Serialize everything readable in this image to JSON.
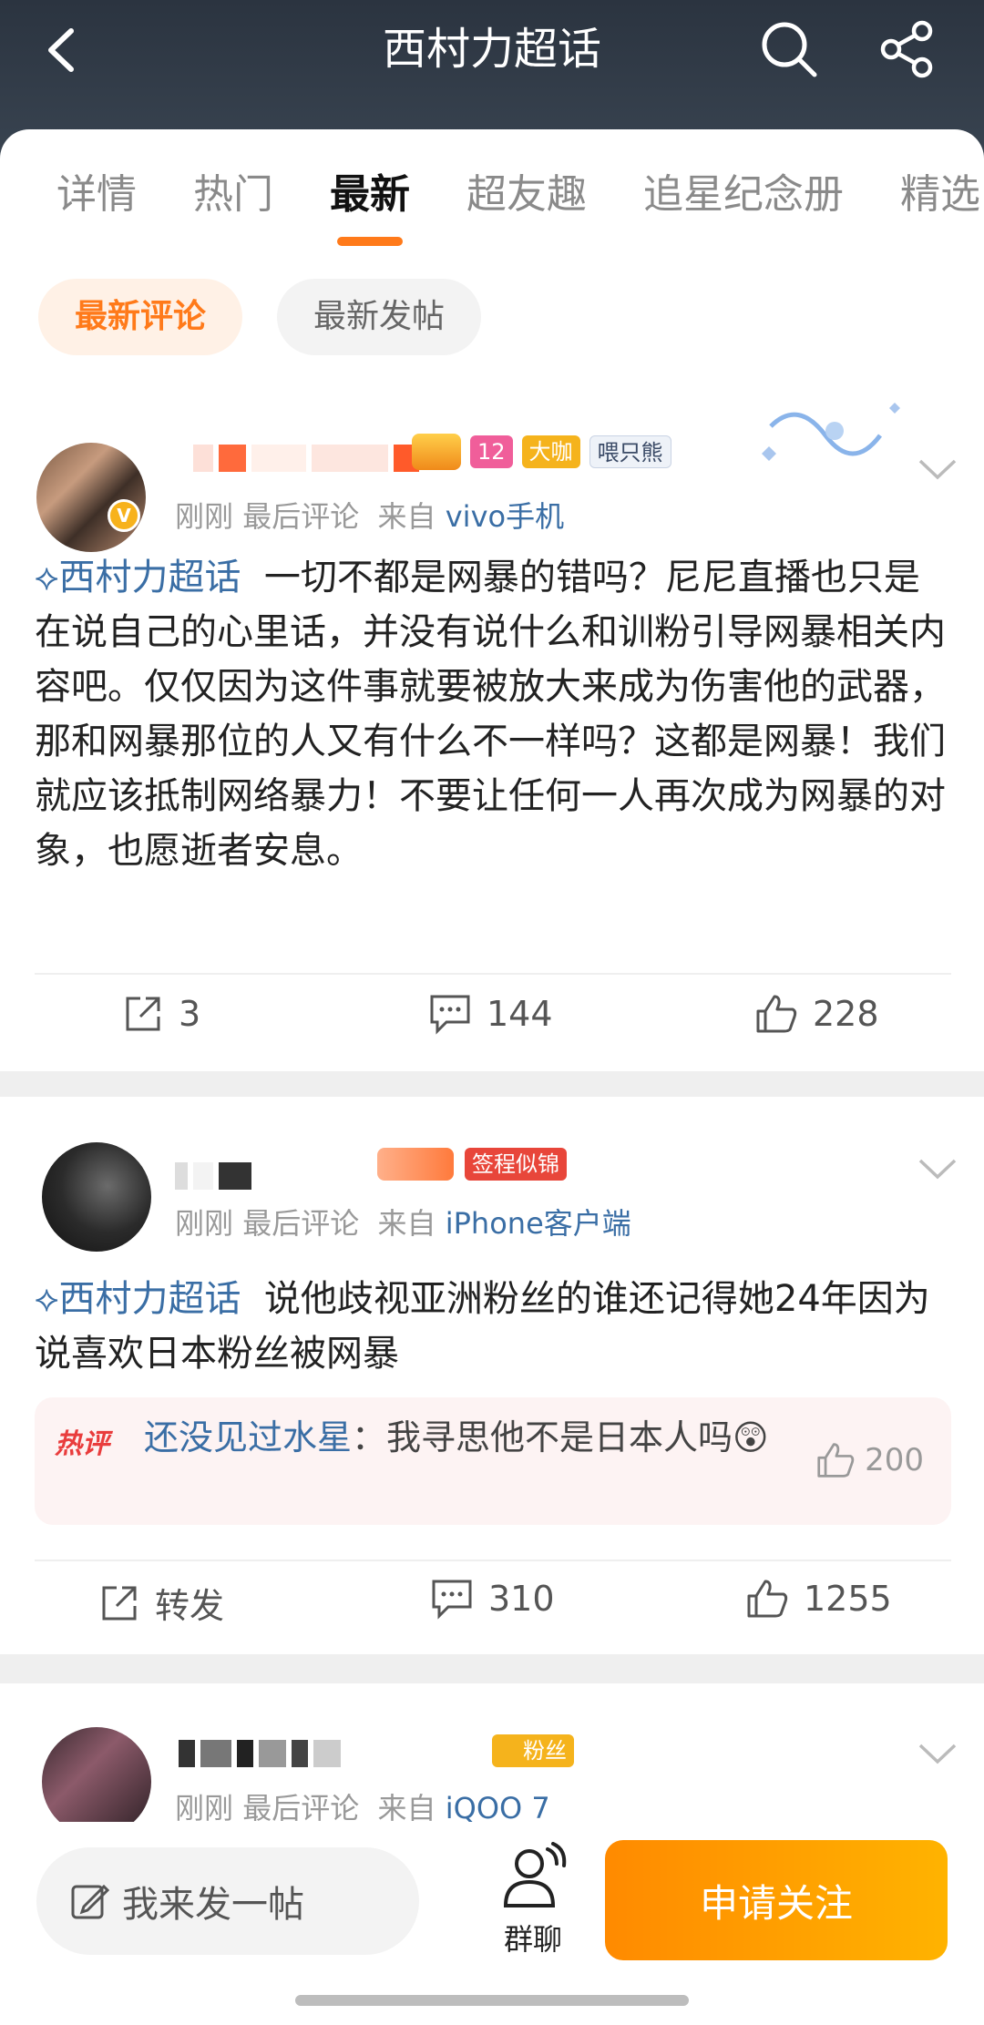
{
  "header": {
    "title": "西村力超话",
    "icons": [
      "back-icon",
      "search-icon",
      "share-icon"
    ]
  },
  "tabs": [
    "详情",
    "热门",
    "最新",
    "超友趣",
    "追星纪念册",
    "精选"
  ],
  "active_tab": "最新",
  "subtabs": {
    "latest_comment": "最新评论",
    "latest_post": "最新发帖"
  },
  "posts": [
    {
      "badges": [
        "大咖",
        "12",
        "喂只熊"
      ],
      "time": "刚刚",
      "last": "最后评论",
      "source_prefix": "来自",
      "source": "vivo手机",
      "topic": "西村力超话",
      "text": "一切不都是网暴的错吗？尼尼直播也只是在说自己的心里话，并没有说什么和训粉引导网暴相关内容吧。仅仅因为这件事就要被放大来成为伤害他的武器，那和网暴那位的人又有什么不一样吗？这都是网暴！我们就应该抵制网络暴力！不要让任何一人再次成为网暴的对象，也愿逝者安息。",
      "repost": "3",
      "comments": "144",
      "likes": "228"
    },
    {
      "badges": [
        "签程似锦"
      ],
      "time": "刚刚",
      "last": "最后评论",
      "source_prefix": "来自",
      "source": "iPhone客户端",
      "topic": "西村力超话",
      "text": "说他歧视亚洲粉丝的谁还记得她24年因为说喜欢日本粉丝被网暴",
      "hot_label": "热评",
      "hot_user": "还没见过水星",
      "hot_text": "：我寻思他不是日本人吗😲",
      "hot_likes": "200",
      "repost": "转发",
      "comments": "310",
      "likes": "1255"
    },
    {
      "badges": [
        "粉丝"
      ],
      "time": "刚刚",
      "last": "最后评论",
      "source_prefix": "来自",
      "source": "iQOO 7"
    }
  ],
  "bottom": {
    "post_input": "我来发一帖",
    "group_chat": "群聊",
    "follow": "申请关注"
  },
  "colors": {
    "accent": "#ff7a1a",
    "link": "#3a6ea5",
    "header_bg": "#2b3440"
  }
}
